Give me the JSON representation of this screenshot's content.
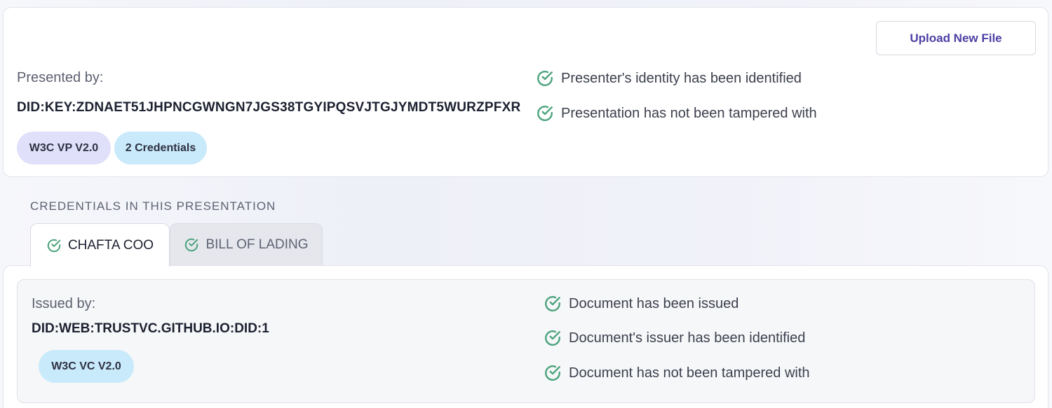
{
  "header": {
    "upload_button": "Upload New File"
  },
  "presentation": {
    "presented_by_label": "Presented by:",
    "presenter_did": "DID:KEY:ZDNAET51JHPNCGWNGN7JGS38TGYIPQSVJTGJYMDT5WURZPFXR",
    "tags": [
      "W3C VP V2.0",
      "2 Credentials"
    ],
    "checks": [
      "Presenter's identity has been identified",
      "Presentation has not been tampered with"
    ]
  },
  "credentials_section": {
    "heading": "CREDENTIALS IN THIS PRESENTATION",
    "tabs": [
      {
        "label": "CHAFTA COO",
        "active": true
      },
      {
        "label": "BILL OF LADING",
        "active": false
      }
    ]
  },
  "credential": {
    "issued_by_label": "Issued by:",
    "issuer_did": "DID:WEB:TRUSTVC.GITHUB.IO:DID:1",
    "tags": [
      "W3C VC V2.0"
    ],
    "checks": [
      "Document has been issued",
      "Document's issuer has been identified",
      "Document has not been tampered with"
    ]
  },
  "colors": {
    "check_green": "#4aa37c",
    "vp_pill": "#e1e0fb",
    "cred_pill": "#c9eafb",
    "button_text": "#4b3fa3"
  },
  "icons": {
    "check": "check-circle-icon"
  }
}
